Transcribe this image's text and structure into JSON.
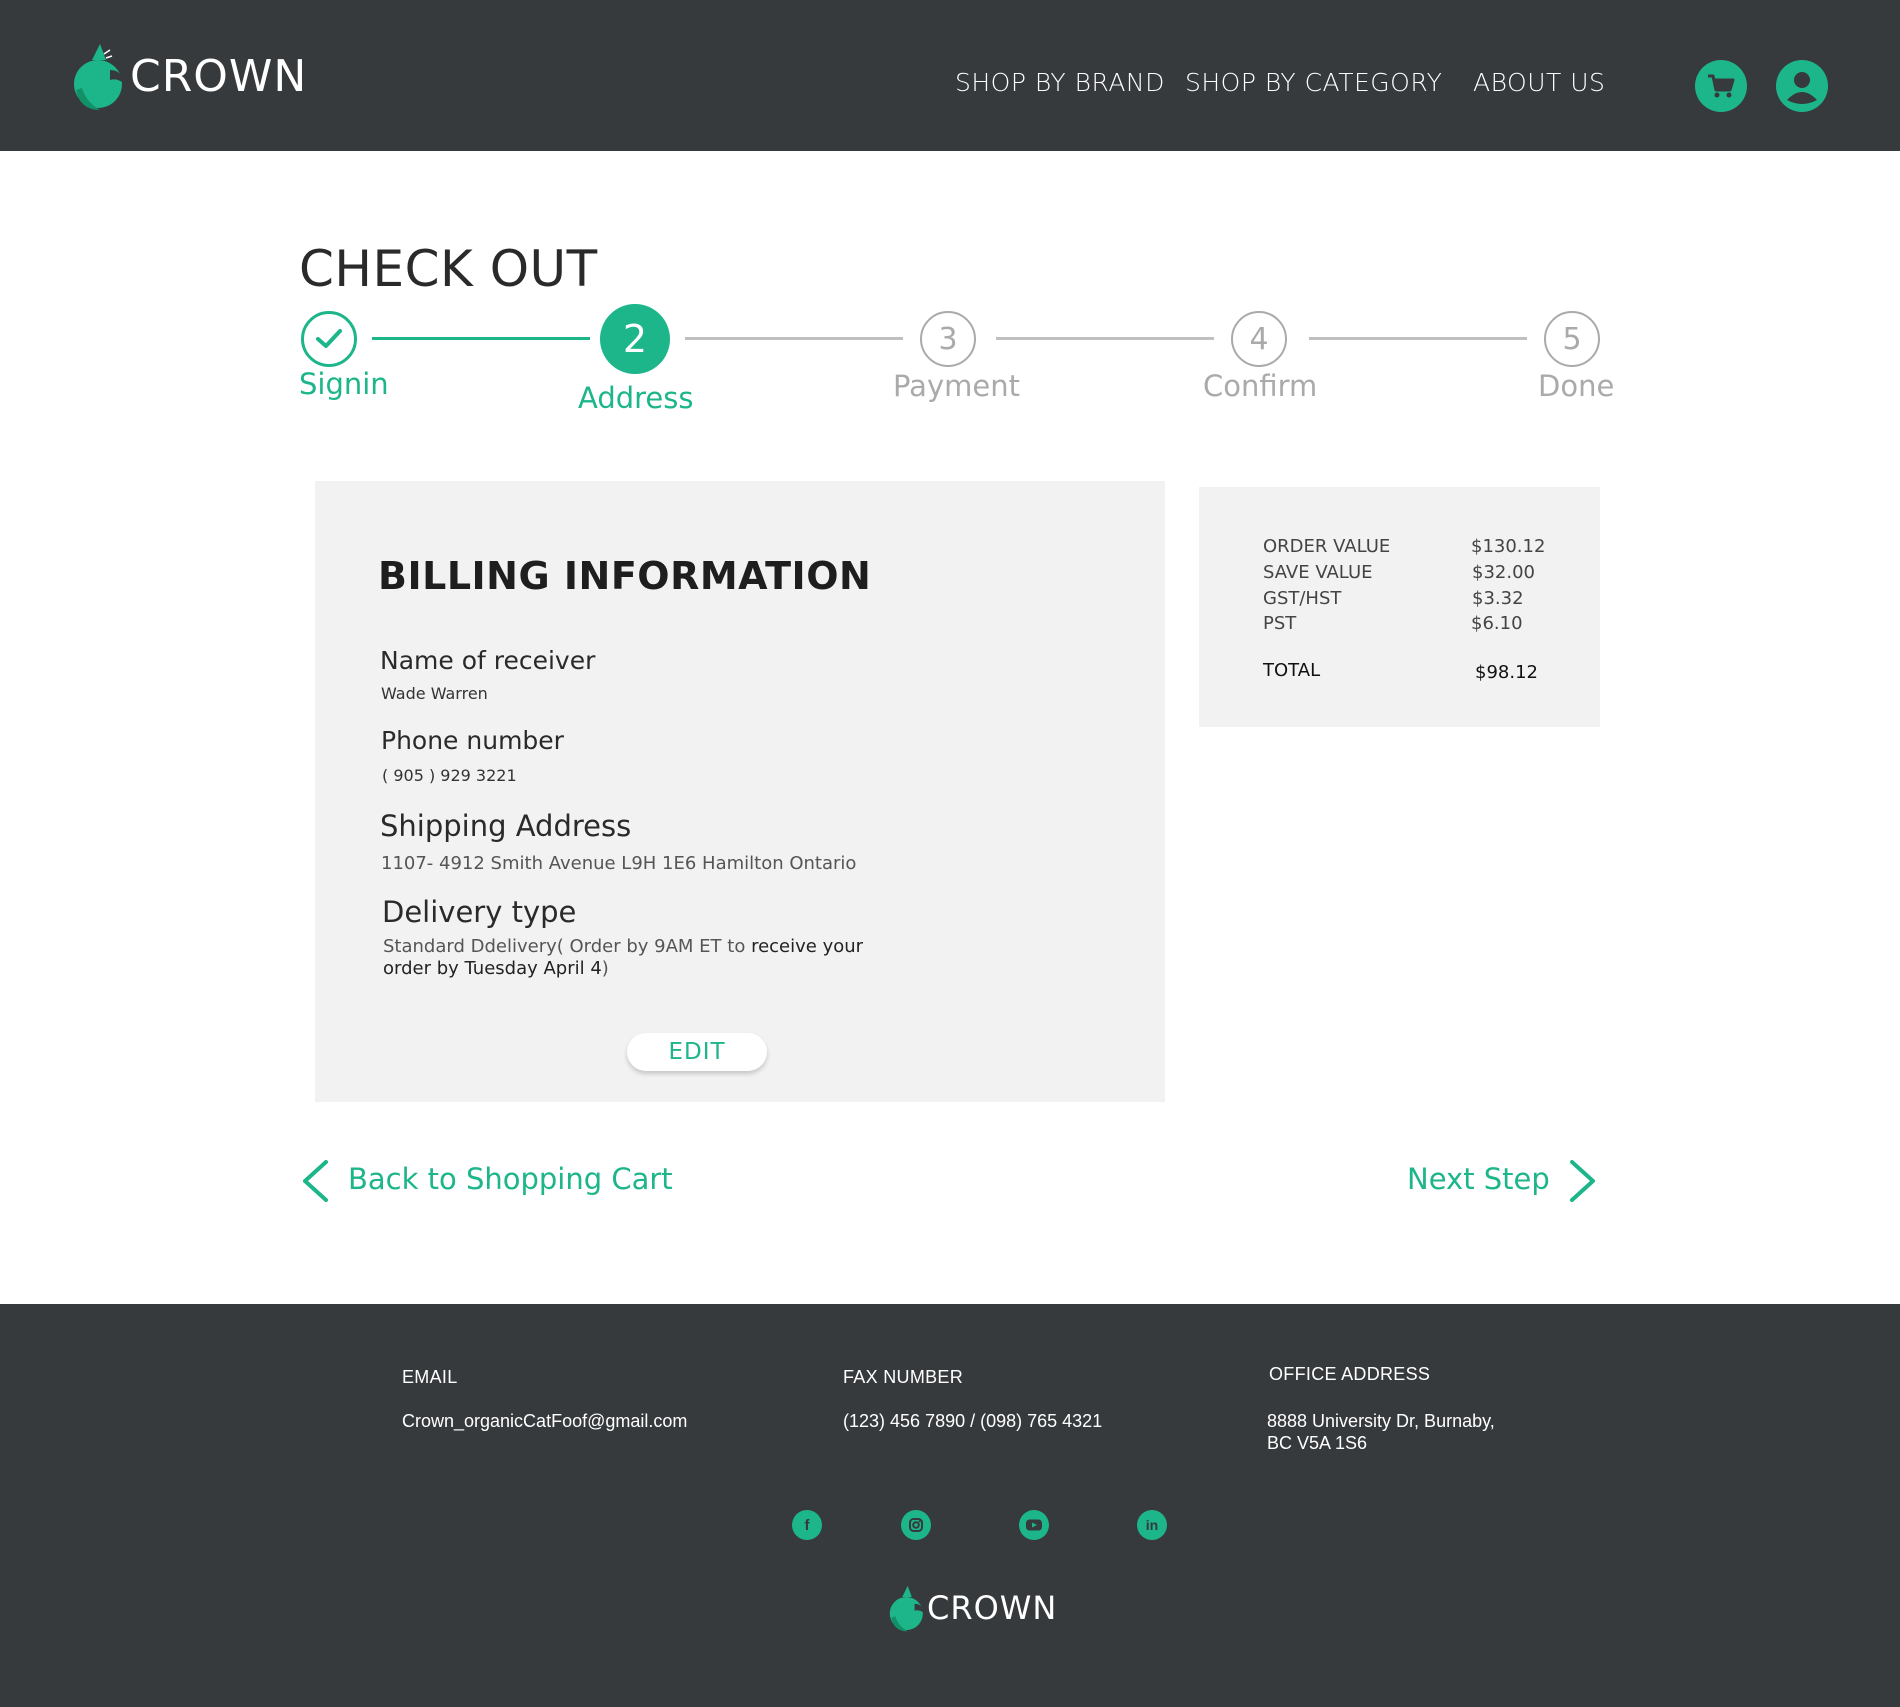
{
  "header": {
    "logo_text": "CROWN",
    "nav": [
      "SHOP BY BRAND",
      "SHOP BY CATEGORY",
      "ABOUT US"
    ],
    "icons": [
      "cart-icon",
      "user-icon"
    ]
  },
  "checkout": {
    "title": "CHECK OUT",
    "steps": [
      {
        "number": "",
        "label": "Signin",
        "state": "done"
      },
      {
        "number": "2",
        "label": "Address",
        "state": "active"
      },
      {
        "number": "3",
        "label": "Payment",
        "state": "todo"
      },
      {
        "number": "4",
        "label": "Confirm",
        "state": "todo"
      },
      {
        "number": "5",
        "label": "Done",
        "state": "todo"
      }
    ]
  },
  "billing": {
    "title": "BILLING INFORMATION",
    "name_label": "Name of receiver",
    "name_value": "Wade Warren",
    "phone_label": "Phone number",
    "phone_value": "( 905 ) 929 3221",
    "address_label": "Shipping Address",
    "address_value": "1107- 4912  Smith Avenue L9H 1E6 Hamilton Ontario",
    "delivery_label": "Delivery type",
    "delivery_line1_a": "Standard Ddelivery( Order by 9AM ET to ",
    "delivery_line1_b": "receive your",
    "delivery_line2_a": "order by Tuesday April 4",
    "delivery_line2_b": ")",
    "edit_label": "EDIT"
  },
  "summary": {
    "rows": [
      {
        "label": "ORDER VALUE",
        "value": "$130.12"
      },
      {
        "label": "SAVE VALUE",
        "value": "$32.00"
      },
      {
        "label": "GST/HST",
        "value": "$3.32"
      },
      {
        "label": "PST",
        "value": "$6.10"
      }
    ],
    "total_label": "TOTAL",
    "total_value": "$98.12"
  },
  "navigation": {
    "back_label": "Back to Shopping Cart",
    "next_label": "Next Step"
  },
  "footer": {
    "email_label": "EMAIL",
    "email_value": "Crown_organicCatFoof@gmail.com",
    "fax_label": "FAX NUMBER",
    "fax_value": "(123) 456 7890 / (098) 765 4321",
    "office_label": "OFFICE ADDRESS",
    "office_line1": "8888 University Dr, Burnaby,",
    "office_line2": "BC V5A 1S6",
    "social": [
      "facebook-icon",
      "instagram-icon",
      "youtube-icon",
      "linkedin-icon"
    ],
    "logo_text": "CROWN"
  },
  "colors": {
    "accent": "#1db58a",
    "dark": "#363a3d",
    "panel": "#f2f2f2",
    "inactive": "#aaaaaa"
  }
}
